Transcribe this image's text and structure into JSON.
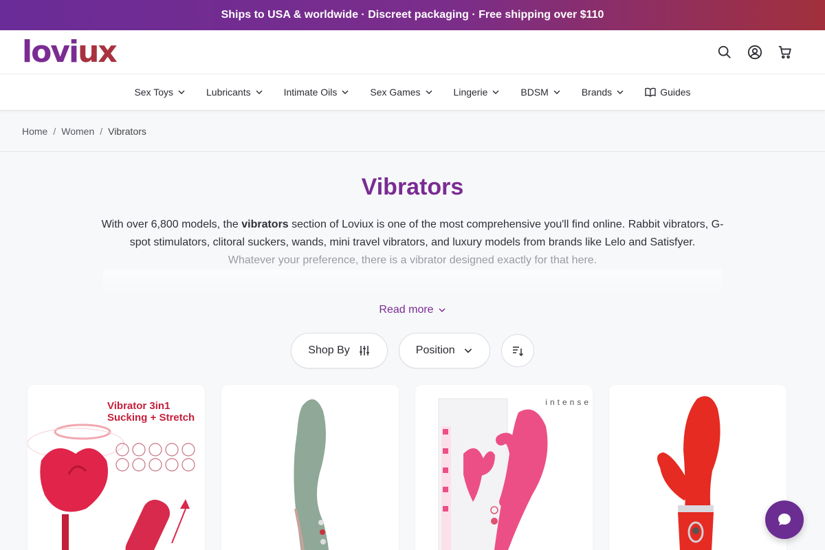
{
  "promo": "Ships to USA & worldwide · Discreet packaging · Free shipping over $110",
  "logo": {
    "part1": "lovi",
    "part2": "ux"
  },
  "header_icons": [
    "search-icon",
    "account-icon",
    "cart-icon"
  ],
  "nav": [
    {
      "label": "Sex Toys"
    },
    {
      "label": "Lubricants"
    },
    {
      "label": "Intimate Oils"
    },
    {
      "label": "Sex Games"
    },
    {
      "label": "Lingerie"
    },
    {
      "label": "BDSM"
    },
    {
      "label": "Brands"
    },
    {
      "label": "Guides"
    }
  ],
  "breadcrumb": {
    "home": "Home",
    "women": "Women",
    "current": "Vibrators",
    "sep": "/"
  },
  "page_title": "Vibrators",
  "description": {
    "pre": "With over 6,800 models, the ",
    "bold": "vibrators",
    "post": " section of Loviux is one of the most comprehensive you'll find online. Rabbit vibrators, G-spot stimulators, clitoral suckers, wands, mini travel vibrators, and luxury models from brands like Lelo and Satisfyer.",
    "faded": "Whatever your preference, there is a vibrator designed exactly for that here."
  },
  "read_more": "Read more",
  "controls": {
    "shop_by": "Shop By",
    "sort": "Position"
  },
  "products": [
    {
      "line1": "Vibrator 3in1",
      "line2": "Sucking + Stretch"
    },
    {},
    {
      "brand": "intense"
    },
    {}
  ],
  "colors": {
    "brand_purple": "#7a2c93",
    "brand_red": "#a8323f",
    "chat": "#6b2d91"
  }
}
